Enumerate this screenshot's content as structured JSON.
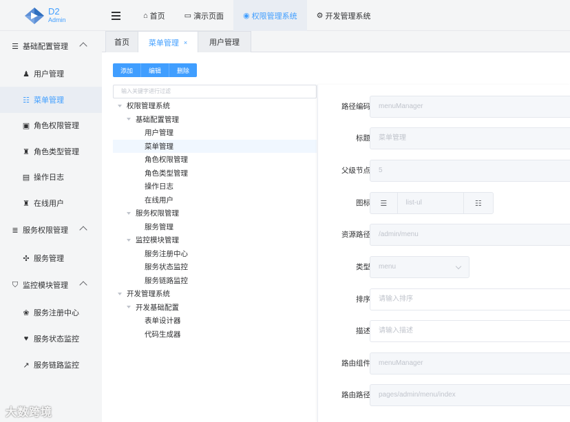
{
  "brand": {
    "title": "D2",
    "subtitle": "Admin",
    "color": "#409eff"
  },
  "topnav": [
    {
      "icon": "home-icon",
      "glyph": "⌂",
      "label": "首页"
    },
    {
      "icon": "folder-icon",
      "glyph": "▭",
      "label": "演示页面"
    },
    {
      "icon": "chrome-icon",
      "glyph": "◉",
      "label": "权限管理系统",
      "active": true
    },
    {
      "icon": "gear-icon",
      "glyph": "⚙",
      "label": "开发管理系统"
    }
  ],
  "sidebar": {
    "groups": [
      {
        "label": "基础配置管理",
        "glyph": "☰",
        "items": [
          {
            "label": "用户管理",
            "glyph": "♟"
          },
          {
            "label": "菜单管理",
            "glyph": "☷",
            "active": true
          },
          {
            "label": "角色权限管理",
            "glyph": "▣"
          },
          {
            "label": "角色类型管理",
            "glyph": "♜"
          },
          {
            "label": "操作日志",
            "glyph": "▤"
          },
          {
            "label": "在线用户",
            "glyph": "♜"
          }
        ]
      },
      {
        "label": "服务权限管理",
        "glyph": "≣",
        "items": [
          {
            "label": "服务管理",
            "glyph": "✣"
          }
        ]
      },
      {
        "label": "监控模块管理",
        "glyph": "⛉",
        "items": [
          {
            "label": "服务注册中心",
            "glyph": "❀"
          },
          {
            "label": "服务状态监控",
            "glyph": "♥"
          },
          {
            "label": "服务链路监控",
            "glyph": "↗"
          }
        ]
      }
    ]
  },
  "watermark": "大数跨境",
  "tabs": [
    {
      "label": "首页"
    },
    {
      "label": "菜单管理",
      "active": true,
      "close": "×"
    },
    {
      "label": "用户管理"
    }
  ],
  "toolbar": {
    "add": "添加",
    "edit": "编辑",
    "delete": "删除"
  },
  "tree": {
    "filter_placeholder": "输入关键字进行过滤",
    "nodes": [
      {
        "label": "权限管理系统",
        "level": 0,
        "arrow": true
      },
      {
        "label": "基础配置管理",
        "level": 1,
        "arrow": true
      },
      {
        "label": "用户管理",
        "level": 2
      },
      {
        "label": "菜单管理",
        "level": 2,
        "selected": true
      },
      {
        "label": "角色权限管理",
        "level": 2
      },
      {
        "label": "角色类型管理",
        "level": 2
      },
      {
        "label": "操作日志",
        "level": 2
      },
      {
        "label": "在线用户",
        "level": 2
      },
      {
        "label": "服务权限管理",
        "level": 1,
        "arrow": true
      },
      {
        "label": "服务管理",
        "level": 2
      },
      {
        "label": "监控模块管理",
        "level": 1,
        "arrow": true
      },
      {
        "label": "服务注册中心",
        "level": 2
      },
      {
        "label": "服务状态监控",
        "level": 2
      },
      {
        "label": "服务链路监控",
        "level": 2
      },
      {
        "label": "开发管理系统",
        "level": 0,
        "arrow": true
      },
      {
        "label": "开发基础配置",
        "level": 1,
        "arrow": true
      },
      {
        "label": "表单设计器",
        "level": 2
      },
      {
        "label": "代码生成器",
        "level": 2
      }
    ]
  },
  "form": {
    "path_code": {
      "label": "路径编码",
      "value": "menuManager"
    },
    "title": {
      "label": "标题",
      "value": "菜单管理"
    },
    "parent": {
      "label": "父级节点",
      "value": "5"
    },
    "icon": {
      "label": "图标",
      "value": "list-ul"
    },
    "resource": {
      "label": "资源路径",
      "value": "/admin/menu"
    },
    "type": {
      "label": "类型",
      "value": "menu"
    },
    "sort": {
      "label": "排序",
      "placeholder": "请输入排序"
    },
    "desc": {
      "label": "描述",
      "placeholder": "请输入描述"
    },
    "component": {
      "label": "路由组件",
      "value": "menuManager"
    },
    "route": {
      "label": "路由路径",
      "value": "pages/admin/menu/index"
    }
  }
}
